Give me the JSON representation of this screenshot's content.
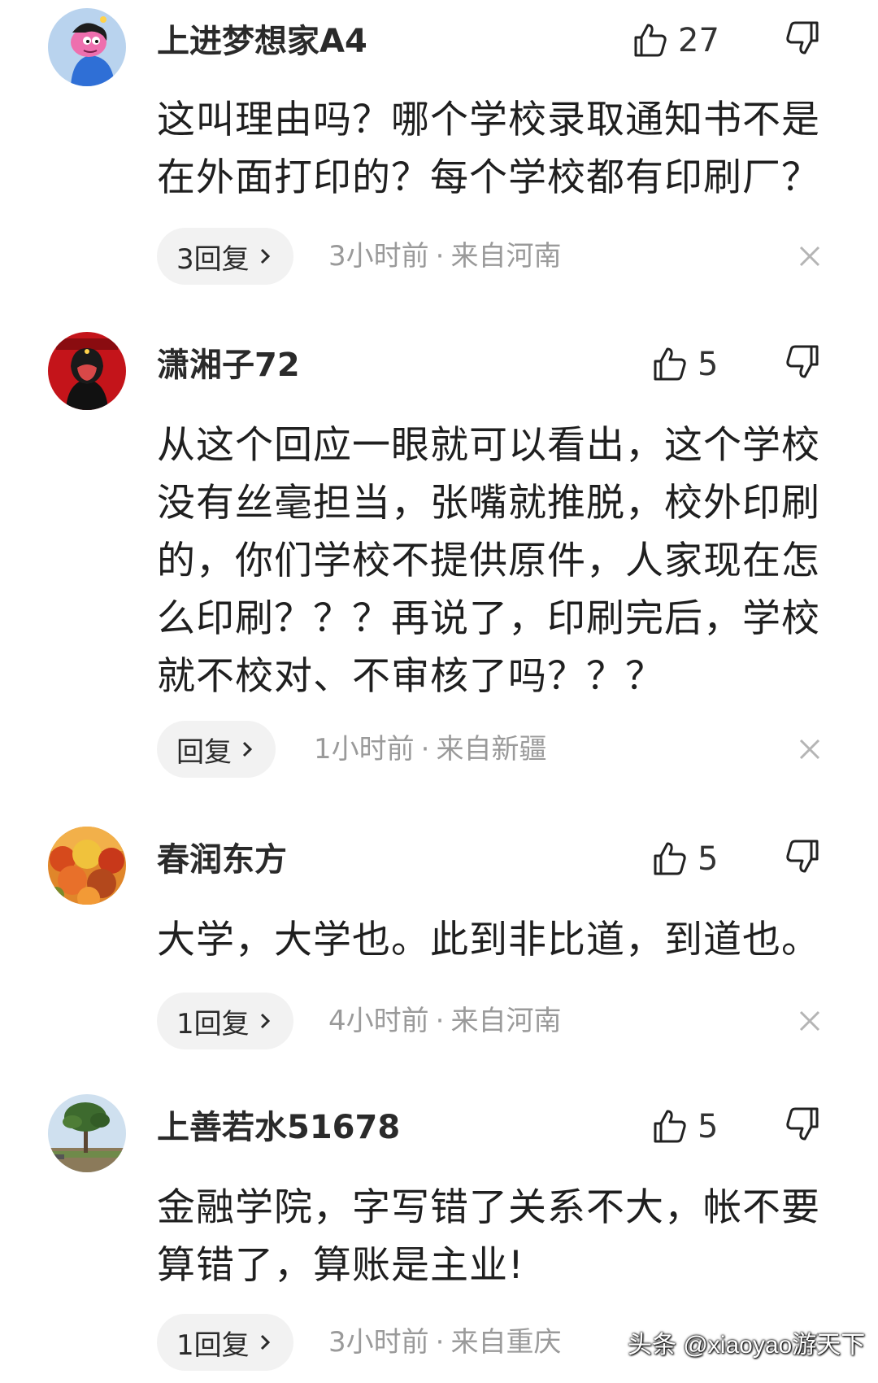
{
  "comments": [
    {
      "username": "上进梦想家A4",
      "likes": "27",
      "text": [
        "这叫理由吗？哪个学校录取通知书不是",
        "在外面打印的？每个学校都有印刷厂？"
      ],
      "reply_label": "3回复",
      "time": "3小时前",
      "location": "来自河南",
      "avatar_icon": "cartoon-character-avatar"
    },
    {
      "username": "潇湘子72",
      "likes": "5",
      "text": [
        "从这个回应一眼就可以看出，这个学校",
        "没有丝毫担当，张嘴就推脱，校外印刷",
        "的，你们学校不提供原件，人家现在怎",
        "么印刷？？？再说了，印刷完后，学校",
        "就不校对、不审核了吗？？？"
      ],
      "reply_label": "回复",
      "time": "1小时前",
      "location": "来自新疆",
      "avatar_icon": "red-portrait-avatar"
    },
    {
      "username": "春润东方",
      "likes": "5",
      "text": [
        "大学，大学也。此到非比道，到道也。"
      ],
      "reply_label": "1回复",
      "time": "4小时前",
      "location": "来自河南",
      "avatar_icon": "autumn-forest-avatar"
    },
    {
      "username": "上善若水51678",
      "likes": "5",
      "text": [
        "金融学院，字写错了关系不大，帐不要",
        "算错了，算账是主业!"
      ],
      "reply_label": "1回复",
      "time": "3小时前",
      "location": "来自重庆",
      "avatar_icon": "tree-landscape-avatar"
    }
  ],
  "separator": "·",
  "watermark": "头条 @xiaoyao游天下",
  "colors": {
    "text": "#1f1f1f",
    "meta": "#9a9a9a",
    "pill": "#f2f2f2"
  }
}
